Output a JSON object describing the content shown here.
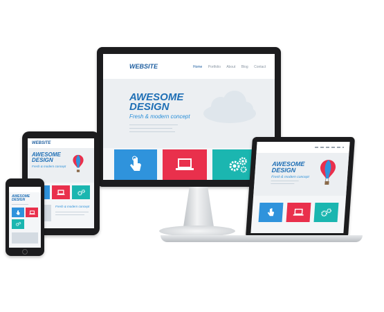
{
  "desktop": {
    "brand": "WEBSITE",
    "nav": [
      "Home",
      "Portfolio",
      "About",
      "Blog",
      "Contact"
    ],
    "headline_line1": "AWESOME",
    "headline_line2": "DESIGN",
    "tagline": "Fresh & modern concept"
  },
  "laptop": {
    "headline_line1": "AWESOME",
    "headline_line2": "DESIGN",
    "tagline": "Fresh & modern concept"
  },
  "tablet": {
    "brand": "WEBSITE",
    "headline_line1": "AWESOME",
    "headline_line2": "DESIGN",
    "tagline": "Fresh & modern concept",
    "bottom_tagline": "Fresh & modern concept"
  },
  "phone": {
    "headline_line1": "AWESOME",
    "headline_line2": "DESIGN"
  },
  "icons": [
    "hand-touch-icon",
    "laptop-icon",
    "gears-icon",
    "cloud-icon",
    "hot-air-balloon-icon"
  ],
  "colors": {
    "blue": "#2f93dc",
    "red": "#e9304c",
    "teal": "#1bb6b0",
    "brand": "#1f5fa0"
  }
}
